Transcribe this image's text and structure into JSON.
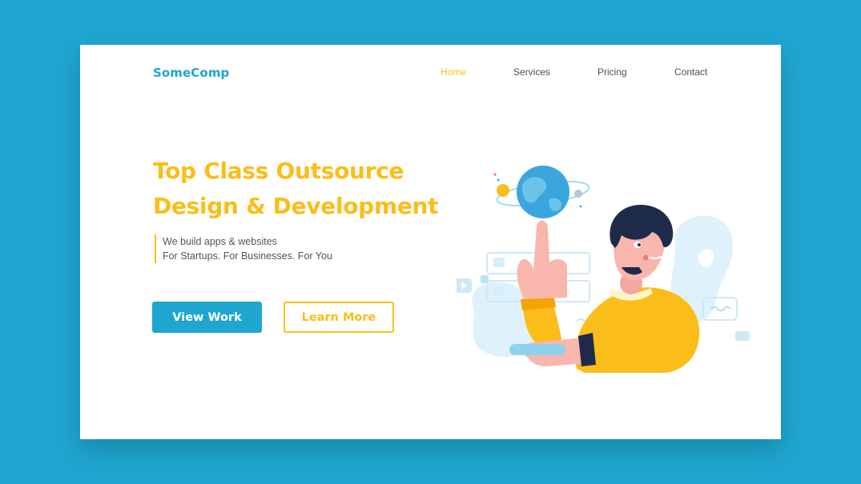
{
  "brand": {
    "name": "SomeComp",
    "color": "#1fa6d0"
  },
  "nav": {
    "items": [
      {
        "label": "Home",
        "active": true
      },
      {
        "label": "Services",
        "active": false
      },
      {
        "label": "Pricing",
        "active": false
      },
      {
        "label": "Contact",
        "active": false
      }
    ]
  },
  "hero": {
    "headline_line1": "Top Class Outsource",
    "headline_line2": "Design & Development",
    "tagline_line1": "We build apps & websites",
    "tagline_line2": "For Startups.  For Businesses.  For You",
    "primary_button": "View Work",
    "secondary_button": "Learn More"
  },
  "illustration": {
    "icon": "developer-spinning-globe-illustration"
  },
  "colors": {
    "background": "#1fa6d0",
    "accent": "#fbbd19",
    "text": "#4f4f4f"
  }
}
